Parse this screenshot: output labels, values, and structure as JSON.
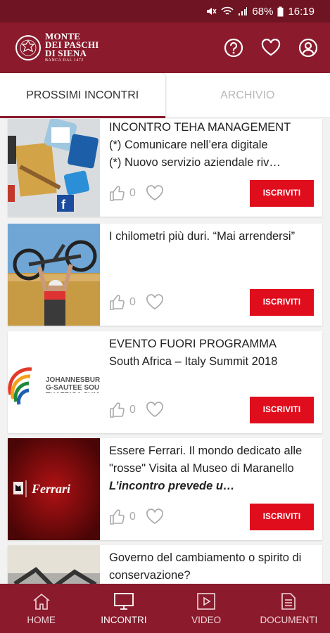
{
  "status_bar": {
    "battery": "68%",
    "time": "16:19"
  },
  "brand": {
    "line1": "MONTE",
    "line2": "DEI PASCHI",
    "line3": "DI SIENA",
    "tagline": "BANCA DAL 1472"
  },
  "header_icons": [
    "help-icon",
    "heart-icon",
    "user-icon"
  ],
  "tabs": [
    {
      "label": "PROSSIMI INCONTRI",
      "active": true
    },
    {
      "label": "ARCHIVIO",
      "active": false
    }
  ],
  "events": [
    {
      "title": "INCONTRO TEHA MANAGEMENT\n(*) Comunicare nell’era digitale\n(*) Nuovo servizio aziendale riv…",
      "likes": "0",
      "button": "ISCRIVITI"
    },
    {
      "title": "I chilometri più duri. “Mai arrendersi”",
      "likes": "0",
      "button": "ISCRIVITI"
    },
    {
      "title": "EVENTO FUORI PROGRAMMA\nSouth Africa – Italy Summit 2018",
      "likes": "0",
      "button": "ISCRIVITI",
      "thumb_text": "JOHANNESBURG-SAUTEE SOUTHAFRICA SUMM"
    },
    {
      "title_plain": "Essere Ferrari. Il mondo dedicato alle \"rosse\" Visita al Museo di Maranello ",
      "title_italic": "L’incontro prevede u…",
      "likes": "0",
      "button": "ISCRIVITI",
      "thumb_text": "Ferrari"
    },
    {
      "title": "Governo del cambiamento o spirito di conservazione?"
    }
  ],
  "bottom_nav": [
    {
      "label": "HOME",
      "icon": "home-icon",
      "active": false
    },
    {
      "label": "INCONTRI",
      "icon": "monitor-icon",
      "active": true
    },
    {
      "label": "VIDEO",
      "icon": "play-icon",
      "active": false
    },
    {
      "label": "DOCUMENTI",
      "icon": "document-icon",
      "active": false
    }
  ],
  "colors": {
    "primary": "#8a1a2c",
    "status_bar": "#6f1422",
    "button": "#e00d1d"
  }
}
